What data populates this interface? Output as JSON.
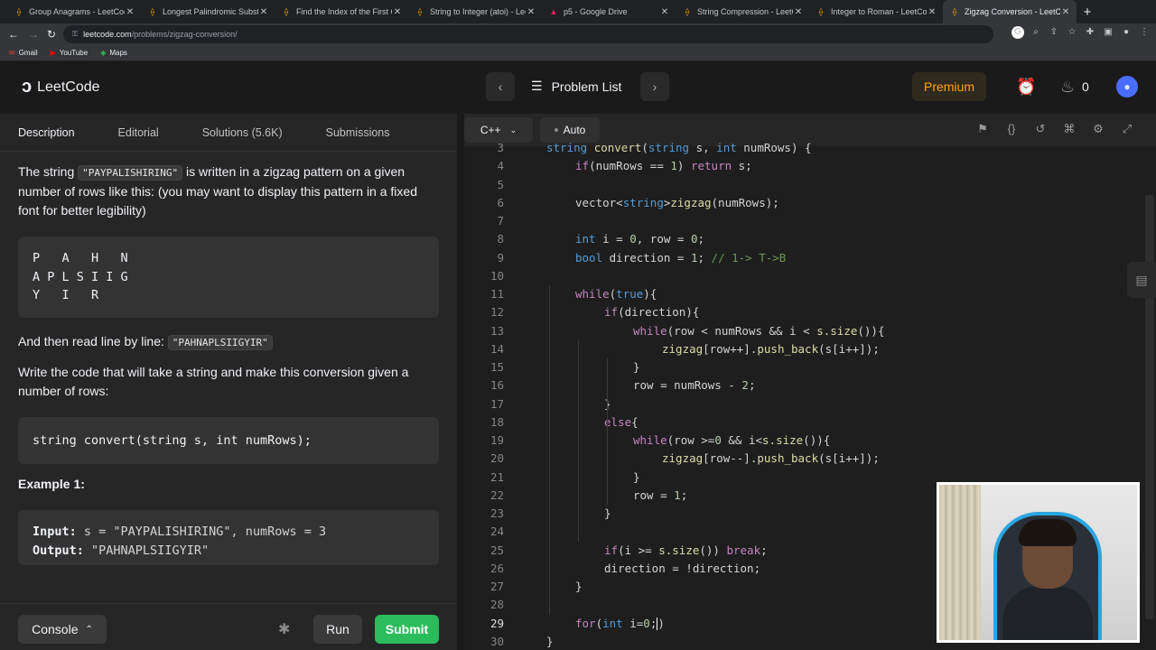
{
  "browser": {
    "tabs": [
      {
        "title": "Group Anagrams - LeetCode",
        "icon": "leetcode-icon",
        "active": false
      },
      {
        "title": "Longest Palindromic Substring",
        "icon": "leetcode-icon",
        "active": false
      },
      {
        "title": "Find the Index of the First Occurrence",
        "icon": "leetcode-icon",
        "active": false
      },
      {
        "title": "String to Integer (atoi) - LeetCode",
        "icon": "leetcode-icon",
        "active": false
      },
      {
        "title": "p5 - Google Drive",
        "icon": "google-drive-icon",
        "active": false
      },
      {
        "title": "String Compression - LeetCode",
        "icon": "leetcode-icon",
        "active": false
      },
      {
        "title": "Integer to Roman - LeetCode",
        "icon": "leetcode-icon",
        "active": false
      },
      {
        "title": "Zigzag Conversion - LeetCode",
        "icon": "leetcode-icon",
        "active": true
      }
    ],
    "url_host": "leetcode.com",
    "url_path": "/problems/zigzag-conversion/",
    "bookmarks": [
      {
        "label": "Gmail",
        "icon": "gmail-icon"
      },
      {
        "label": "YouTube",
        "icon": "youtube-icon"
      },
      {
        "label": "Maps",
        "icon": "maps-icon"
      }
    ]
  },
  "header": {
    "logo_text": "LeetCode",
    "problem_list": "Problem List",
    "premium": "Premium",
    "streak_count": "0"
  },
  "left": {
    "tabs": [
      "Description",
      "Editorial",
      "Solutions (5.6K)",
      "Submissions"
    ],
    "p1_pre": "The string ",
    "p1_code": "\"PAYPALISHIRING\"",
    "p1_post": " is written in a zigzag pattern on a given number of rows like this: (you may want to display this pattern in a fixed font for better legibility)",
    "pattern": "P   A   H   N\nA P L S I I G\nY   I   R",
    "p2_pre": "And then read line by line: ",
    "p2_code": "\"PAHNAPLSIIGYIR\"",
    "p3": "Write the code that will take a string and make this conversion given a number of rows:",
    "signature": "string convert(string s, int numRows);",
    "example_title": "Example 1:",
    "input_label": "Input:",
    "input_value": " s = \"PAYPALISHIRING\", numRows = 3",
    "output_label": "Output:",
    "output_value": " \"PAHNAPLSIIGYIR\"",
    "console": "Console",
    "run": "Run",
    "submit": "Submit"
  },
  "editor": {
    "language": "C++",
    "mode": "Auto",
    "cursor_line": 29
  }
}
